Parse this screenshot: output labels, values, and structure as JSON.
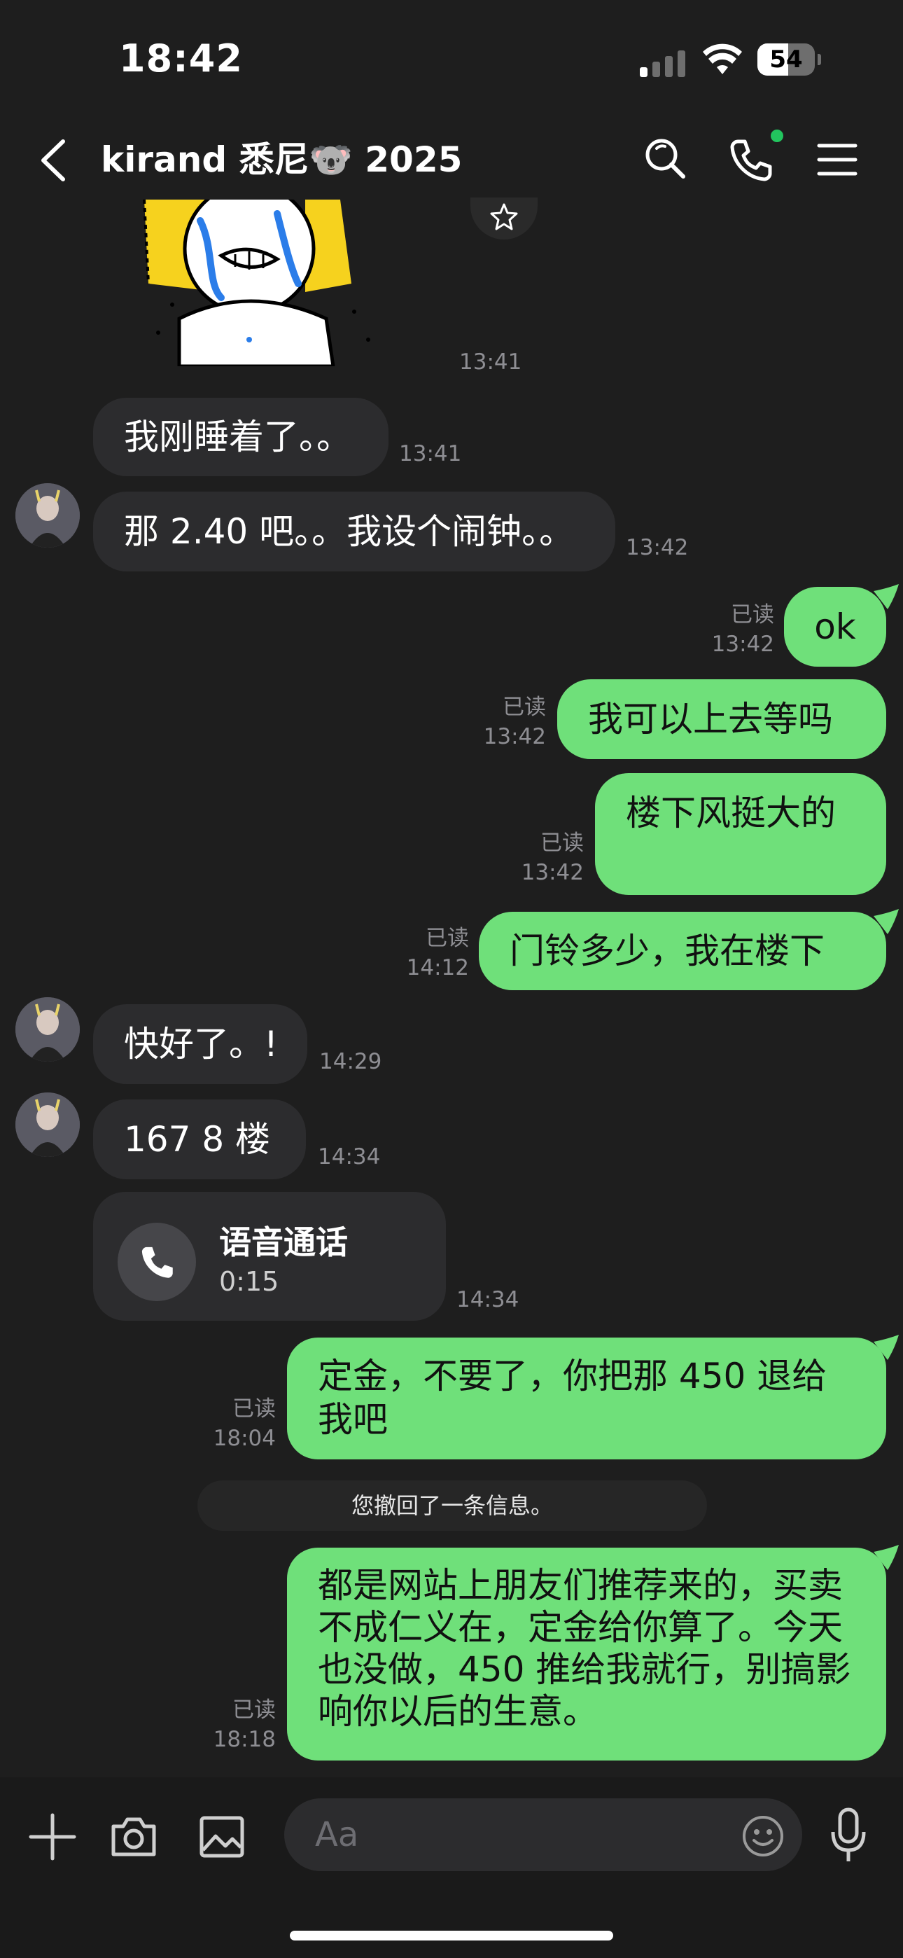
{
  "status_bar": {
    "time": "18:42",
    "battery": "54",
    "battery_level": 0.54
  },
  "header": {
    "title": "kirand 悉尼🐨  2025",
    "online": true
  },
  "sticker": {
    "timestamp": "13:41"
  },
  "messages": [
    {
      "text": "我刚睡着了。。",
      "time": "13:41"
    },
    {
      "text": "那 2.40 吧。。我设个闹钟。。",
      "time": "13:42"
    },
    {
      "text": "ok",
      "status": "已读",
      "time": "13:42"
    },
    {
      "text": "我可以上去等吗",
      "status": "已读",
      "time": "13:42"
    },
    {
      "text": "楼下风挺大的",
      "status": "已读",
      "time": "13:42"
    },
    {
      "text": "门铃多少，我在楼下",
      "status": "已读",
      "time": "14:12"
    },
    {
      "text": "快好了。!",
      "time": "14:29"
    },
    {
      "text": "167  8 楼",
      "time": "14:34"
    },
    {
      "type": "call",
      "title": "语音通话",
      "duration": "0:15",
      "time": "14:34"
    },
    {
      "text": "定金，不要了，你把那 450 退给我吧",
      "status": "已读",
      "time": "18:04"
    },
    {
      "type": "system",
      "text": "您撤回了一条信息。"
    },
    {
      "text": "都是网站上朋友们推荐来的，买卖不成仁义在，定金给你算了。今天也没做，450 推给我就行，别搞影响你以后的生意。",
      "status": "已读",
      "time": "18:18"
    }
  ],
  "input": {
    "placeholder": "Aa"
  },
  "colors": {
    "outgoing_bubble": "#6fe07a",
    "incoming_bubble": "#2c2c2e",
    "background": "#1e1e1e",
    "online_dot": "#22c55e"
  },
  "icons": {
    "header": [
      "back-icon",
      "search-icon",
      "phone-icon",
      "menu-icon"
    ],
    "toolbar": [
      "plus-icon",
      "camera-icon",
      "image-icon",
      "emoji-icon",
      "microphone-icon"
    ]
  }
}
